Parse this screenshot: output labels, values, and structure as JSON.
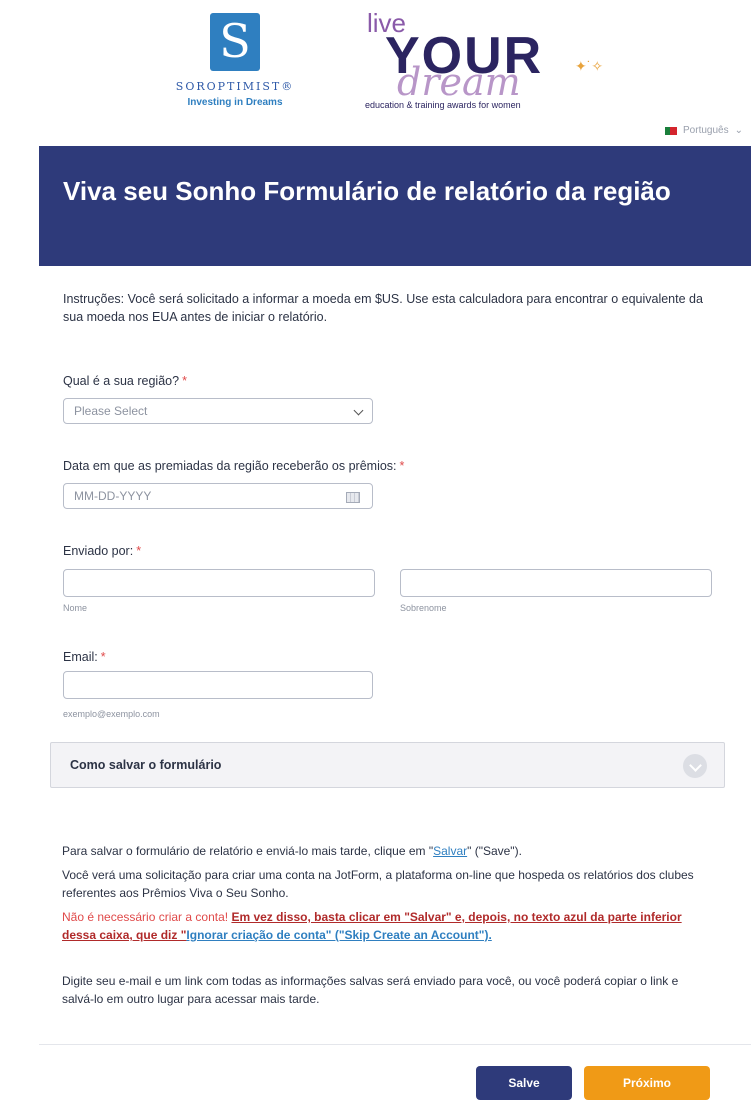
{
  "logos": {
    "soroptimist_name": "SOROPTIMIST®",
    "soroptimist_tagline": "Investing in Dreams",
    "lyd_live": "live",
    "lyd_your": "YOUR",
    "lyd_dream": "dream",
    "lyd_tagline": "education & training awards for women"
  },
  "language": {
    "selected": "Português"
  },
  "header": {
    "title": "Viva seu Sonho Formulário de relatório da região"
  },
  "instructions": "Instruções: Você será solicitado a informar a moeda em $US. Use esta calculadora para encontrar o equivalente da sua moeda nos EUA antes de iniciar o relatório.",
  "fields": {
    "region": {
      "label": "Qual é a sua região?",
      "required": "*",
      "value": "Please Select"
    },
    "date": {
      "label": "Data em que as premiadas da região receberão os prêmios:",
      "required": "*",
      "placeholder": "MM-DD-YYYY"
    },
    "sent_by": {
      "label": "Enviado por:",
      "required": "*",
      "first_sub": "Nome",
      "last_sub": "Sobrenome"
    },
    "email": {
      "label": "Email:",
      "required": "*",
      "sub": "exemplo@exemplo.com"
    }
  },
  "collapse": {
    "title": "Como salvar o formulário"
  },
  "info": {
    "p1_before": "Para salvar o formulário de relatório e enviá-lo mais tarde, clique em \"",
    "p1_link": "Salvar",
    "p1_after": "\" (\"Save\").",
    "p2": "Você verá uma solicitação para criar uma conta na JotForm, a plataforma on-line que hospeda os relatórios dos clubes referentes aos Prêmios Viva o Seu Sonho.",
    "p3_red": "Não é necessário criar a conta!",
    "p3_bold": "Em vez disso, basta clicar em \"Salvar\" e, depois, no texto azul da parte inferior dessa caixa, que diz \"",
    "p3_link": "Ignorar criação de conta\" (\"Skip Create an Account\").",
    "p4": "Digite seu e-mail e um link com todas as informações salvas será enviado para você, ou você poderá copiar o link e salvá-lo em outro lugar para acessar mais tarde."
  },
  "buttons": {
    "save": "Salve",
    "next": "Próximo"
  },
  "colors": {
    "header": "#2e3a7a",
    "next_button": "#f09a16",
    "required": "#e04a4a"
  }
}
